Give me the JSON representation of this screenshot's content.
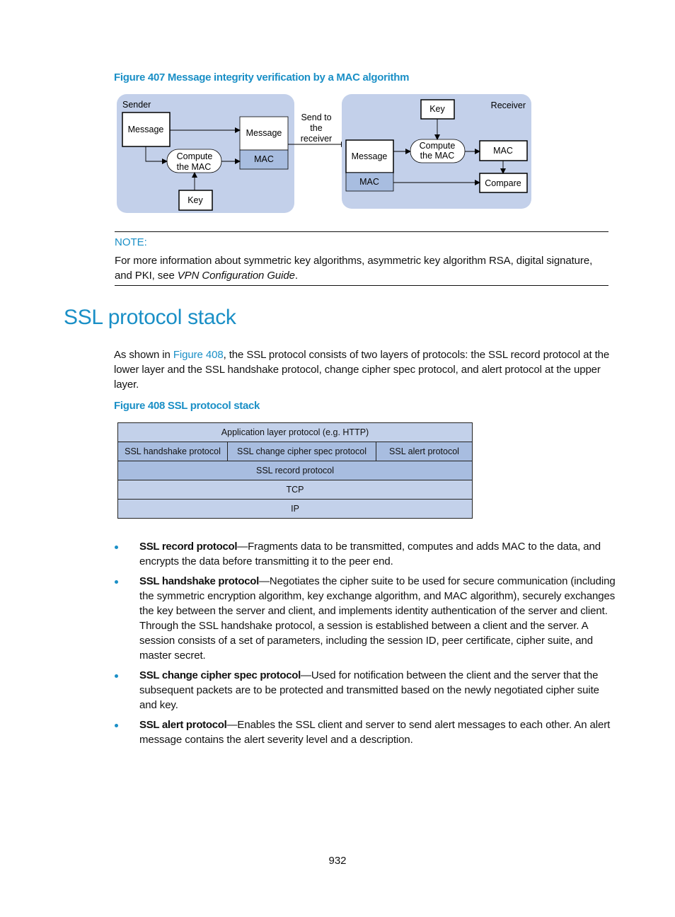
{
  "figure407": {
    "caption": "Figure 407 Message integrity verification by a MAC algorithm",
    "sender": {
      "label": "Sender",
      "message": "Message",
      "compute_line1": "Compute",
      "compute_line2": "the MAC",
      "key": "Key",
      "packet_message": "Message",
      "packet_mac": "MAC"
    },
    "send_label_line1": "Send to",
    "send_label_line2": "the",
    "send_label_line3": "receiver",
    "receiver": {
      "label": "Receiver",
      "key": "Key",
      "packet_message": "Message",
      "packet_mac": "MAC",
      "compute_line1": "Compute",
      "compute_line2": "the MAC",
      "mac": "MAC",
      "compare": "Compare"
    },
    "colors": {
      "panel": "#c3d0ea",
      "mac_fill": "#a8bde0"
    }
  },
  "note": {
    "title": "NOTE:",
    "text_before": "For more information about symmetric key algorithms, asymmetric key algorithm RSA, digital signature, and PKI, see ",
    "italic_ref": "VPN Configuration Guide",
    "text_after": "."
  },
  "section": {
    "heading": "SSL protocol stack",
    "intro_before": "As shown in ",
    "intro_link": "Figure 408",
    "intro_after": ", the SSL protocol consists of two layers of protocols: the SSL record protocol at the lower layer and the SSL handshake protocol, change cipher spec protocol, and alert protocol at the upper layer."
  },
  "figure408": {
    "caption": "Figure 408 SSL protocol stack",
    "layers": {
      "application": "Application layer protocol (e.g. HTTP)",
      "handshake": "SSL handshake protocol",
      "change_cipher": "SSL change cipher spec protocol",
      "alert": "SSL alert protocol",
      "record": "SSL record protocol",
      "tcp": "TCP",
      "ip": "IP"
    }
  },
  "bullets": [
    {
      "term": "SSL record protocol",
      "text": "—Fragments data to be transmitted, computes and adds MAC to the data, and encrypts the data before transmitting it to the peer end."
    },
    {
      "term": "SSL handshake protocol",
      "text": "—Negotiates the cipher suite to be used for secure communication (including the symmetric encryption algorithm, key exchange algorithm, and MAC algorithm), securely exchanges the key between the server and client, and implements identity authentication of the server and client. Through the SSL handshake protocol, a session is established between a client and the server. A session consists of a set of parameters, including the session ID, peer certificate, cipher suite, and master secret."
    },
    {
      "term": "SSL change cipher spec protocol",
      "text": "—Used for notification between the client and the server that the subsequent packets are to be protected and transmitted based on the newly negotiated cipher suite and key."
    },
    {
      "term": "SSL alert protocol",
      "text": "—Enables the SSL client and server to send alert messages to each other. An alert message contains the alert severity level and a description."
    }
  ],
  "page_number": "932"
}
